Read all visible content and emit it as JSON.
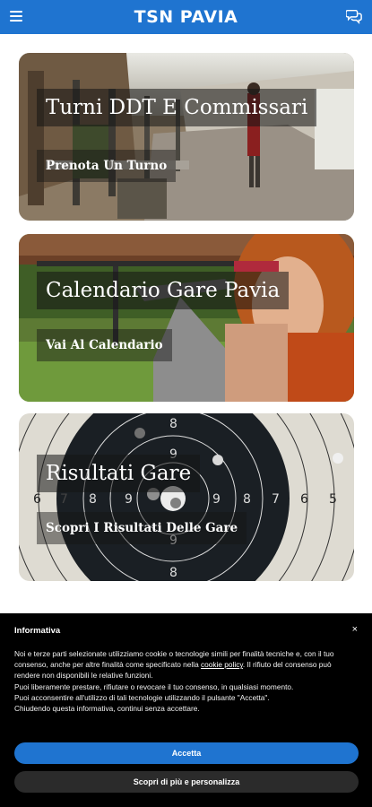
{
  "header": {
    "title": "TSN PAVIA"
  },
  "cards": [
    {
      "title": "Turni DDT E Commissari",
      "link": "Prenota Un Turno"
    },
    {
      "title": "Calendario Gare Pavia",
      "link": "Vai Al Calendario"
    },
    {
      "title": "Risultati Gare",
      "link": "Scopri I Risultati Delle Gare"
    }
  ],
  "cookie": {
    "heading": "Informativa",
    "close": "×",
    "text_1": "Noi e terze parti selezionate utilizziamo cookie o tecnologie simili per finalità tecniche e, con il tuo consenso, anche per altre finalità come specificato nella ",
    "link": "cookie policy",
    "text_2": ". Il rifiuto del consenso può rendere non disponibili le relative funzioni.",
    "text_3": "Puoi liberamente prestare, rifiutare o revocare il tuo consenso, in qualsiasi momento.",
    "text_4": "Puoi acconsentire all'utilizzo di tali tecnologie utilizzando il pulsante \"Accetta\".",
    "text_5": "Chiudendo questa informativa, continui senza accettare.",
    "accept": "Accetta",
    "more": "Scopri di più e personalizza"
  },
  "target_numbers": {
    "left": [
      "6",
      "7",
      "8",
      "9"
    ],
    "right": [
      "9",
      "8",
      "7",
      "6",
      "5"
    ],
    "top": [
      "8",
      "9"
    ],
    "bottom": [
      "9",
      "8"
    ]
  },
  "colors": {
    "brand": "#1f74d0",
    "banner_bg": "#000000"
  }
}
